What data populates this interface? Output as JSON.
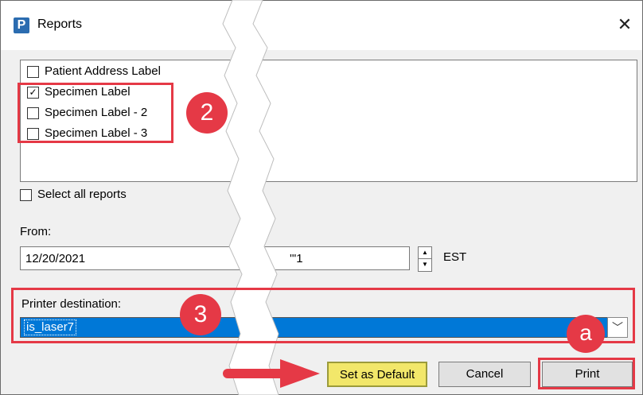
{
  "window": {
    "title": "Reports",
    "app_icon_letter": "P",
    "close_glyph": "✕"
  },
  "reports": [
    {
      "label": "Patient Address Label",
      "checked": false
    },
    {
      "label": "Specimen Label",
      "checked": true
    },
    {
      "label": "Specimen Label - 2",
      "checked": false
    },
    {
      "label": "Specimen Label - 3",
      "checked": false
    }
  ],
  "select_all": {
    "label": "Select all reports",
    "checked": false
  },
  "from": {
    "label": "From:",
    "value": "12/20/2021",
    "partial_value": "'\"1",
    "timezone": "EST"
  },
  "printer": {
    "label": "Printer destination:",
    "value": "is_laser7"
  },
  "buttons": {
    "set_default": "Set as Default",
    "cancel": "Cancel",
    "print": "Print"
  },
  "annotations": {
    "badge_2": "2",
    "badge_3": "3",
    "badge_a": "a",
    "accent_color": "#e53946"
  }
}
